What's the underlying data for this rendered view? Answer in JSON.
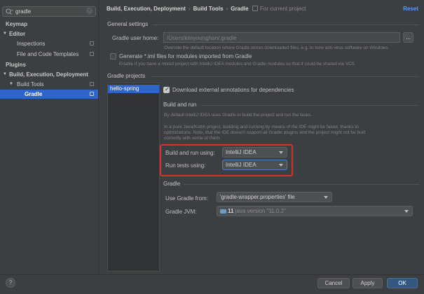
{
  "search": {
    "value": "gradle"
  },
  "sidebar": {
    "items": [
      {
        "label": "Keymap"
      },
      {
        "label": "Editor"
      },
      {
        "label": "Inspections"
      },
      {
        "label": "File and Code Templates"
      },
      {
        "label": "Plugins"
      },
      {
        "label": "Build, Execution, Deployment"
      },
      {
        "label": "Build Tools"
      },
      {
        "label": "Gradle"
      }
    ]
  },
  "header": {
    "crumb1": "Build, Execution, Deployment",
    "crumb2": "Build Tools",
    "crumb3": "Gradle",
    "current_project": "For current project",
    "reset": "Reset"
  },
  "general": {
    "title": "General settings",
    "user_home_label": "Gradle user home:",
    "user_home_value": "/Users/kimyounghan/.gradle",
    "user_home_hint": "Override the default location where Gradle stores downloaded files, e.g. to tune anti-virus software on Windows",
    "browse": "...",
    "iml_label": "Generate *.iml files for modules imported from Gradle",
    "iml_hint": "Enable if you have a mixed project with IntelliJ IDEA modules and Gradle modules so that it could be shared via VCS"
  },
  "projects": {
    "title": "Gradle projects",
    "list": [
      "hello-spring"
    ],
    "download_label": "Download external annotations for dependencies",
    "build_run_title": "Build and run",
    "build_run_hint1": "By default IntelliJ IDEA uses Gradle to build the project and run the tasks.",
    "build_run_hint2a": "In a pure Java/Kotlin project, building and running by means of the IDE might be faster, thanks to",
    "build_run_hint2b": "optimizations. Note, that the IDE doesn't support all Gradle plugins and the project might not be built",
    "build_run_hint2c": "correctly with some of them.",
    "build_using_label": "Build and run using:",
    "build_using_value": "IntelliJ IDEA",
    "tests_using_label": "Run tests using:",
    "tests_using_value": "IntelliJ IDEA",
    "gradle_title": "Gradle",
    "use_gradle_label": "Use Gradle from:",
    "use_gradle_value": "'gradle-wrapper.properties' file",
    "jvm_label": "Gradle JVM:",
    "jvm_version": "11",
    "jvm_detail": "java version \"11.0.2\""
  },
  "footer": {
    "help": "?",
    "cancel": "Cancel",
    "apply": "Apply",
    "ok": "OK"
  },
  "colors": {
    "accent": "#2f65ca",
    "highlight": "#d7312a",
    "link": "#589df6"
  }
}
